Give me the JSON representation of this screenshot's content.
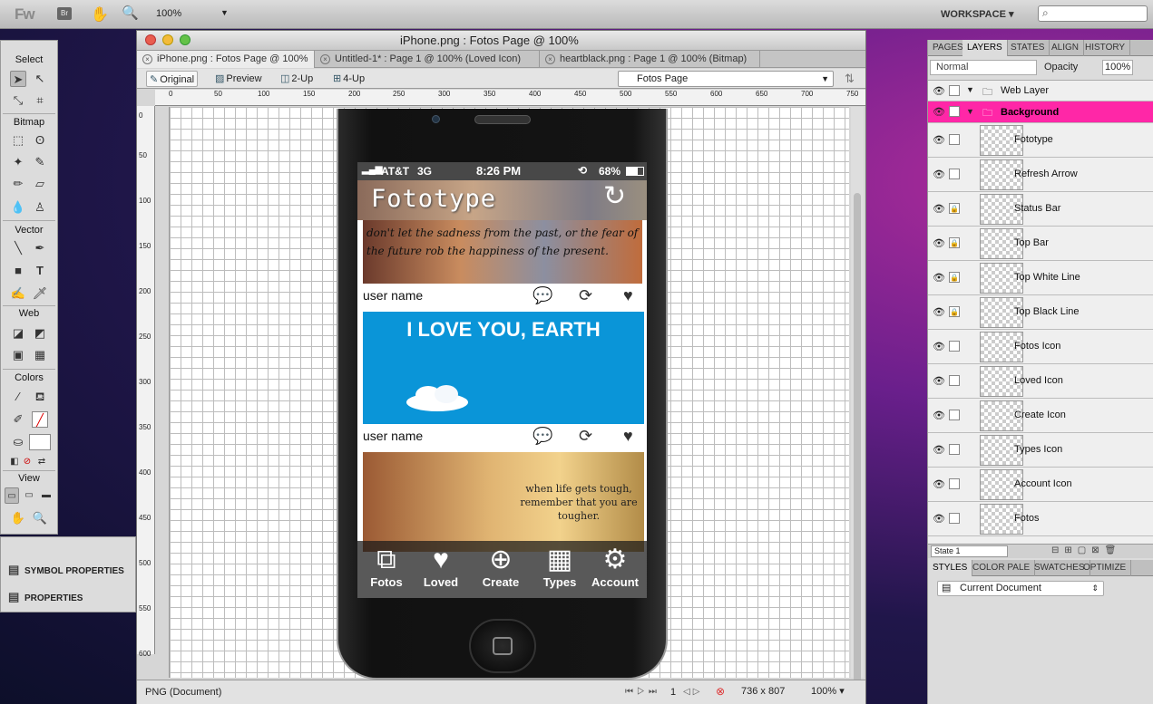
{
  "app": {
    "logo": "Fw",
    "bridge": "Br",
    "zoom": "100%",
    "workspace": "WORKSPACE ▾",
    "search_placeholder": ""
  },
  "tools": {
    "sections": [
      "Select",
      "Bitmap",
      "Vector",
      "Web",
      "Colors",
      "View"
    ]
  },
  "properties": {
    "symbol": "SYMBOL PROPERTIES",
    "props": "PROPERTIES"
  },
  "document": {
    "title": "iPhone.png : Fotos Page @ 100%",
    "tabs": [
      "iPhone.png : Fotos Page @ 100%",
      "Untitled-1* : Page 1 @ 100% (Loved Icon)",
      "heartblack.png : Page 1 @ 100% (Bitmap)"
    ],
    "views": [
      "Original",
      "Preview",
      "2-Up",
      "4-Up"
    ],
    "page": "Fotos Page",
    "hruler": [
      "0",
      "50",
      "100",
      "150",
      "200",
      "250",
      "300",
      "350",
      "400",
      "450",
      "500",
      "550",
      "600",
      "650",
      "700",
      "750"
    ],
    "vruler": [
      "0",
      "50",
      "100",
      "150",
      "200",
      "250",
      "300",
      "350",
      "400",
      "450",
      "500",
      "550",
      "600"
    ],
    "status": {
      "format": "PNG (Document)",
      "page_num": "1",
      "size": "736 x 807",
      "zoom": "100% ▾"
    }
  },
  "phone": {
    "status": {
      "carrier": "AT&T",
      "network": "3G",
      "time": "8:26 PM",
      "battery": "68%"
    },
    "app_title": "Fototype",
    "posts": [
      {
        "quote": "don't let the sadness from the past, or the fear of the future rob the happiness of the present.",
        "user": "user name"
      },
      {
        "headline": "I LOVE YOU, EARTH",
        "user": "user name"
      },
      {
        "quote": "when life gets tough, remember that you are tougher."
      }
    ],
    "tabs": [
      "Fotos",
      "Loved",
      "Create",
      "Types",
      "Account"
    ]
  },
  "right_panel": {
    "tabs": [
      "PAGES",
      "LAYERS",
      "STATES",
      "ALIGN",
      "HISTORY"
    ],
    "blend": "Normal",
    "opacity_label": "Opacity",
    "opacity": "100%",
    "layers": [
      {
        "name": "Web Layer",
        "group": true
      },
      {
        "name": "Background",
        "group": true,
        "selected": true
      },
      {
        "name": "Fototype"
      },
      {
        "name": "Refresh Arrow"
      },
      {
        "name": "Status Bar",
        "locked": true
      },
      {
        "name": "Top Bar",
        "locked": true
      },
      {
        "name": "Top White Line",
        "locked": true
      },
      {
        "name": "Top Black Line",
        "locked": true
      },
      {
        "name": "Fotos Icon"
      },
      {
        "name": "Loved Icon"
      },
      {
        "name": "Create Icon"
      },
      {
        "name": "Types Icon"
      },
      {
        "name": "Account Icon"
      },
      {
        "name": "Fotos"
      }
    ],
    "state": "State 1",
    "styles_tabs": [
      "STYLES",
      "COLOR PALE",
      "SWATCHES",
      "OPTIMIZE"
    ],
    "styles_doc": "Current Document"
  },
  "colors": {
    "selection": "#ff27a7",
    "earth_bg": "#0a95d8"
  }
}
